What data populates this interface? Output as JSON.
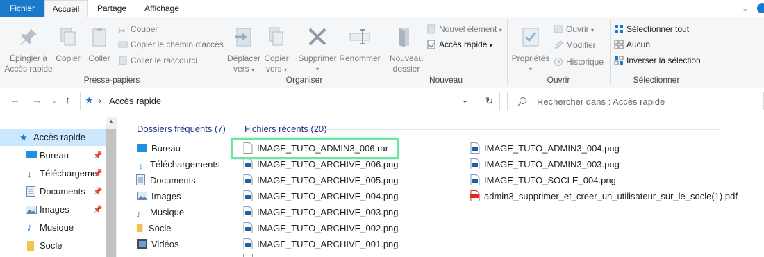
{
  "tabs": {
    "file": "Fichier",
    "home": "Accueil",
    "share": "Partage",
    "view": "Affichage"
  },
  "ribbon": {
    "clipboard": {
      "group": "Presse-papiers",
      "pin_line1": "Épingler à",
      "pin_line2": "Accès rapide",
      "copy": "Copier",
      "paste": "Coller",
      "cut": "Couper",
      "copy_path": "Copier le chemin d'accès",
      "paste_shortcut": "Coller le raccourci"
    },
    "organize": {
      "group": "Organiser",
      "move_line1": "Déplacer",
      "move_line2": "vers",
      "copyto_line1": "Copier",
      "copyto_line2": "vers",
      "delete": "Supprimer",
      "rename": "Renommer"
    },
    "new": {
      "group": "Nouveau",
      "folder_line1": "Nouveau",
      "folder_line2": "dossier",
      "new_item": "Nouvel élément",
      "easy_access": "Accès rapide"
    },
    "open": {
      "group": "Ouvrir",
      "properties": "Propriétés",
      "open": "Ouvrir",
      "edit": "Modifier",
      "history": "Historique"
    },
    "select": {
      "group": "Sélectionner",
      "select_all": "Sélectionner tout",
      "none": "Aucun",
      "invert": "Inverser la sélection"
    }
  },
  "address": {
    "path": "Accès rapide",
    "search_placeholder": "Rechercher dans : Accès rapide"
  },
  "nav": [
    {
      "label": "Accès rapide",
      "icon": "star-icon"
    },
    {
      "label": "Bureau",
      "icon": "desktop-icon"
    },
    {
      "label": "Téléchargeme",
      "icon": "download-icon"
    },
    {
      "label": "Documents",
      "icon": "documents-icon"
    },
    {
      "label": "Images",
      "icon": "pictures-icon"
    },
    {
      "label": "Musique",
      "icon": "music-icon"
    },
    {
      "label": "Socle",
      "icon": "folder-icon"
    }
  ],
  "frequent": {
    "header": "Dossiers fréquents (7)",
    "items": [
      "Bureau",
      "Téléchargements",
      "Documents",
      "Images",
      "Musique",
      "Socle",
      "Vidéos"
    ]
  },
  "recent": {
    "header": "Fichiers récents (20)",
    "col1": [
      "IMAGE_TUTO_ADMIN3_006.rar",
      "IMAGE_TUTO_ARCHIVE_006.png",
      "IMAGE_TUTO_ARCHIVE_005.png",
      "IMAGE_TUTO_ARCHIVE_004.png",
      "IMAGE_TUTO_ARCHIVE_003.png",
      "IMAGE_TUTO_ARCHIVE_002.png",
      "IMAGE_TUTO_ARCHIVE_001.png"
    ],
    "col2": [
      "IMAGE_TUTO_ADMIN3_004.png",
      "IMAGE_TUTO_ADMIN3_003.png",
      "IMAGE_TUTO_SOCLE_004.png",
      "admin3_supprimer_et_creer_un_utilisateur_sur_le_socle(1).pdf"
    ]
  }
}
